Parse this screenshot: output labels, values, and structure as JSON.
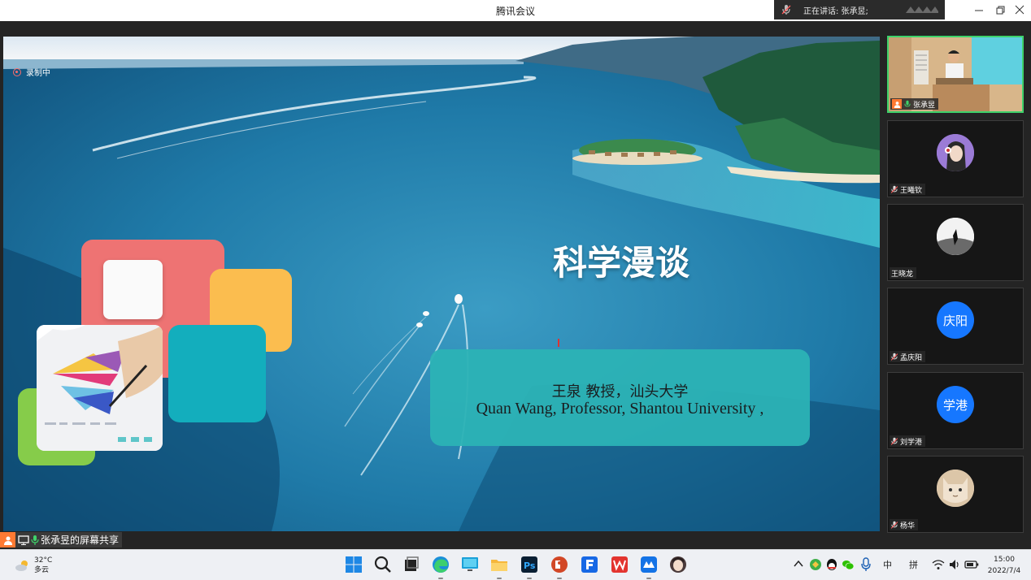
{
  "window": {
    "title": "腾讯会议",
    "speaking_label": "正在讲话: 张承昱;",
    "icons": {
      "minimize": "minimize-icon",
      "maximize": "maximize-icon",
      "close": "close-icon"
    }
  },
  "share": {
    "recording_label": "录制中",
    "slide": {
      "title": "科学漫谈",
      "presenter_cn": "王泉  教授，汕头大学",
      "presenter_en": "Quan Wang, Professor, Shantou University ,"
    },
    "share_label": "张承昱的屏幕共享"
  },
  "participants": [
    {
      "name": "张承昱",
      "type": "video",
      "speaking": true
    },
    {
      "name": "王曦钦",
      "type": "avatar",
      "mic_muted": true
    },
    {
      "name": "王晓龙",
      "type": "avatar",
      "mic_muted": false
    },
    {
      "name": "孟庆阳",
      "type": "initials",
      "initials": "庆阳",
      "mic_muted": true
    },
    {
      "name": "刘学港",
      "type": "initials",
      "initials": "学港",
      "mic_muted": true
    },
    {
      "name": "杨华",
      "type": "avatar",
      "mic_muted": true
    }
  ],
  "taskbar": {
    "weather": {
      "temp": "32°C",
      "desc": "多云"
    },
    "apps": [
      "windows-start-icon",
      "search-icon",
      "task-view-icon",
      "edge-browser-icon",
      "monitor-icon",
      "file-explorer-icon",
      "photoshop-icon",
      "powerpoint-icon",
      "foxit-f-icon",
      "wps-office-icon",
      "tencent-meeting-icon",
      "anime-avatar-app-icon"
    ],
    "tray": {
      "ime_lang": "中",
      "ime_mode": "拼"
    },
    "clock": {
      "time": "15:00",
      "date": "2022/7/4"
    }
  },
  "colors": {
    "meeting_bg": "#242424",
    "active_speaker_border": "#3ed26a",
    "initials_avatar": "#1677ff",
    "slide_teal_box": "#2cb3b6",
    "slide_red": "#ee7373",
    "slide_yellow": "#fbbd4f",
    "slide_teal": "#13aebd",
    "slide_green": "#86cc4a"
  }
}
